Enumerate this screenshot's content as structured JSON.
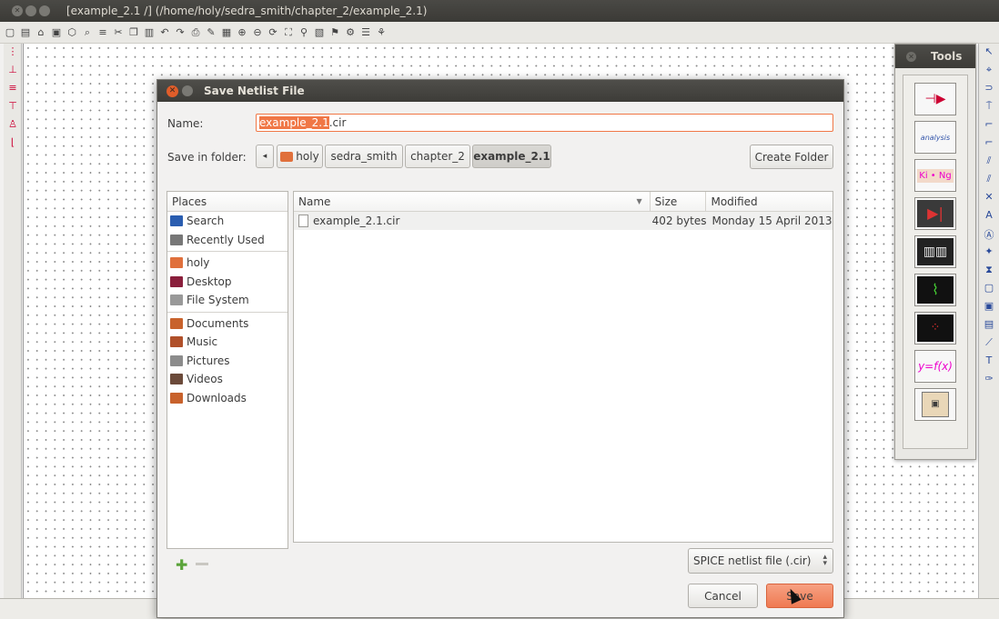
{
  "window": {
    "title": "[example_2.1 /] (/home/holy/sedra_smith/chapter_2/example_2.1)"
  },
  "tools_palette": {
    "title": "Tools",
    "buttons": [
      {
        "name": "eeschema",
        "icon": "schematic-icon",
        "text": ""
      },
      {
        "name": "gerbview",
        "icon": "analysis-icon",
        "text": "analysis"
      },
      {
        "name": "kicad-ngspice",
        "icon": "kingspice-icon",
        "text": "Ki • Ng"
      },
      {
        "name": "model-editor",
        "icon": "diode-model-icon",
        "text": ""
      },
      {
        "name": "subcircuit",
        "icon": "subcircuit-icon",
        "text": ""
      },
      {
        "name": "pcb",
        "icon": "pcb-icon",
        "text": ""
      },
      {
        "name": "modelica",
        "icon": "modelica-icon",
        "text": ""
      },
      {
        "name": "function",
        "icon": "function-icon",
        "text": "y=f(x)"
      },
      {
        "name": "chip",
        "icon": "chip-icon",
        "text": ""
      }
    ]
  },
  "dialog": {
    "title": "Save Netlist File",
    "name_label": "Name:",
    "name_selected": "example_2.1",
    "name_rest": ".cir",
    "save_in_label": "Save in folder:",
    "breadcrumbs": [
      "holy",
      "sedra_smith",
      "chapter_2",
      "example_2.1"
    ],
    "create_folder": "Create Folder",
    "places_header": "Places",
    "places": [
      {
        "label": "Search",
        "icon": "search-icon"
      },
      {
        "label": "Recently Used",
        "icon": "recent-icon"
      },
      {
        "sep": true
      },
      {
        "label": "holy",
        "icon": "home-folder-icon"
      },
      {
        "label": "Desktop",
        "icon": "desktop-icon"
      },
      {
        "label": "File System",
        "icon": "filesystem-icon"
      },
      {
        "sep": true
      },
      {
        "label": "Documents",
        "icon": "documents-icon"
      },
      {
        "label": "Music",
        "icon": "music-icon"
      },
      {
        "label": "Pictures",
        "icon": "pictures-icon"
      },
      {
        "label": "Videos",
        "icon": "videos-icon"
      },
      {
        "label": "Downloads",
        "icon": "downloads-icon"
      }
    ],
    "columns": {
      "name": "Name",
      "size": "Size",
      "modified": "Modified"
    },
    "files": [
      {
        "name": "example_2.1.cir",
        "size": "402 bytes",
        "modified": "Monday 15 April 2013"
      }
    ],
    "filter": "SPICE netlist file (.cir)",
    "cancel": "Cancel",
    "save": "Save"
  },
  "colors": {
    "accent": "#f07746",
    "titlebar": "#3c3b37"
  }
}
